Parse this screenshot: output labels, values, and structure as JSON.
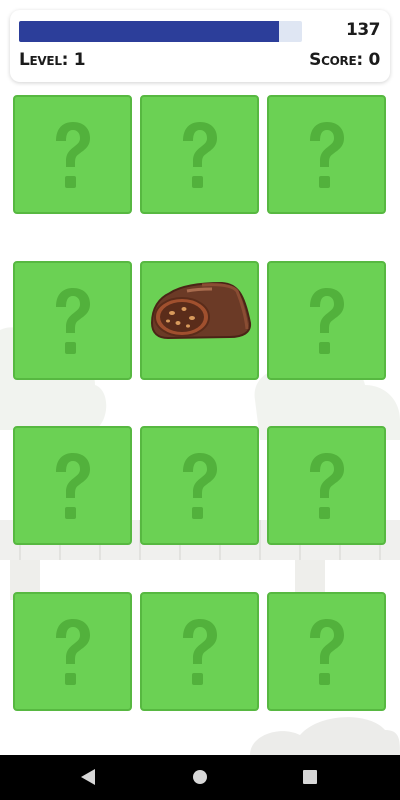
{
  "hud": {
    "time_remaining": "137",
    "timer_fraction": 0.92,
    "level": "Level: 1",
    "score": "Score: 0"
  },
  "board": {
    "rows": 4,
    "cols": 3,
    "cards": [
      {
        "state": "hidden",
        "icon": "question-mark-icon"
      },
      {
        "state": "hidden",
        "icon": "question-mark-icon"
      },
      {
        "state": "hidden",
        "icon": "question-mark-icon"
      },
      {
        "state": "hidden",
        "icon": "question-mark-icon"
      },
      {
        "state": "revealed",
        "icon": "chocolate-bar-icon"
      },
      {
        "state": "hidden",
        "icon": "question-mark-icon"
      },
      {
        "state": "hidden",
        "icon": "question-mark-icon"
      },
      {
        "state": "hidden",
        "icon": "question-mark-icon"
      },
      {
        "state": "hidden",
        "icon": "question-mark-icon"
      },
      {
        "state": "hidden",
        "icon": "question-mark-icon"
      },
      {
        "state": "hidden",
        "icon": "question-mark-icon"
      },
      {
        "state": "hidden",
        "icon": "question-mark-icon"
      }
    ]
  },
  "navbar": {
    "buttons": [
      "back-icon",
      "home-icon",
      "recents-icon"
    ]
  },
  "colors": {
    "card_face": "#6bd154",
    "card_border": "#57b841",
    "question_mark": "#52b13c",
    "timer_fill": "#2c3e9a"
  }
}
